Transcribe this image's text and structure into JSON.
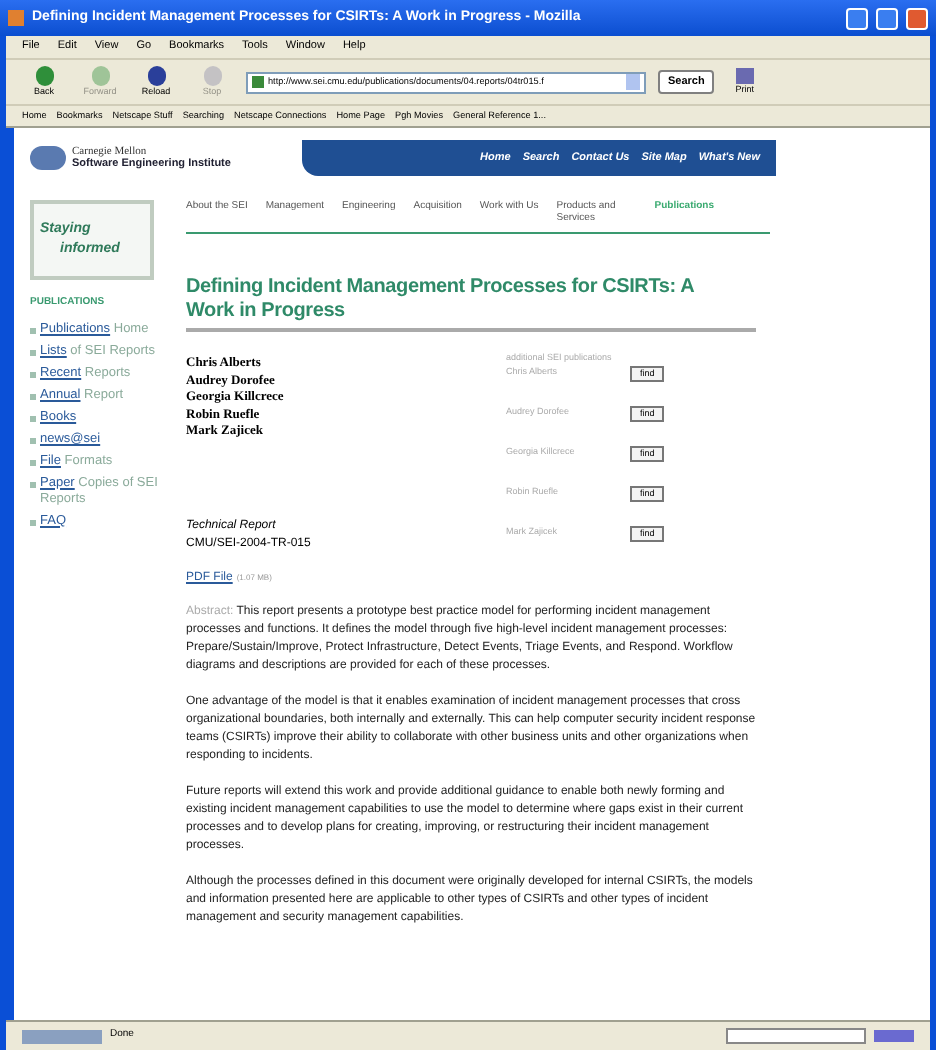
{
  "window": {
    "title": "Defining Incident Management Processes for CSIRTs: A Work in Progress - Mozilla"
  },
  "menu": [
    "File",
    "Edit",
    "View",
    "Go",
    "Bookmarks",
    "Tools",
    "Window",
    "Help"
  ],
  "toolbar": [
    {
      "label": "Back",
      "disabled": false
    },
    {
      "label": "Forward",
      "disabled": true
    },
    {
      "label": "Reload",
      "disabled": false
    },
    {
      "label": "Stop",
      "disabled": true
    }
  ],
  "address": {
    "value": "http://www.sei.cmu.edu/publications/documents/04.reports/04tr015.f"
  },
  "search_button": "Search",
  "print_button": "Print",
  "bookmarks": [
    "Home",
    "Bookmarks",
    "Netscape Stuff",
    "Searching",
    "Netscape Connections",
    "Home Page",
    "Pgh Movies",
    "General Reference 1..."
  ],
  "page": {
    "logo": {
      "line_1": "Carnegie Mellon",
      "line_2": "Software Engineering Institute"
    },
    "top_nav": [
      "Home",
      "Search",
      "Contact Us",
      "Site Map",
      "What's New"
    ],
    "banner": {
      "line_1": "Staying",
      "line_2": "informed"
    },
    "section_nav": [
      {
        "label": "About the SEI",
        "selected": false
      },
      {
        "label": "Management",
        "selected": false
      },
      {
        "label": "Engineering",
        "selected": false
      },
      {
        "label": "Acquisition",
        "selected": false
      },
      {
        "label": "Work with Us",
        "selected": false
      },
      {
        "label": "Products and Services",
        "selected": false
      },
      {
        "label": "Publications",
        "selected": true
      }
    ],
    "sidebar": {
      "heading": "PUBLICATIONS",
      "items": [
        {
          "link": "Publications",
          "rest": "Home"
        },
        {
          "link": "Lists",
          "rest": "of SEI Reports"
        },
        {
          "link": "Recent",
          "rest": "Reports"
        },
        {
          "link": "Annual",
          "rest": "Report"
        },
        {
          "link": "Books"
        },
        {
          "link": "news@sei"
        },
        {
          "link": "File",
          "rest": "Formats"
        },
        {
          "link": "Paper",
          "rest": "Copies of SEI Reports"
        },
        {
          "link": "FAQ"
        }
      ]
    },
    "title": "Defining Incident Management Processes for CSIRTs: A Work in Progress",
    "authors": [
      "Chris Alberts",
      "Audrey Dorofee",
      "Georgia Killcrece",
      "Robin Ruefle",
      "Mark Zajicek"
    ],
    "related": {
      "heading": "additional SEI publications",
      "rows": [
        {
          "name": "Chris Alberts",
          "button": "find"
        },
        {
          "name": "Audrey Dorofee",
          "button": "find"
        },
        {
          "name": "Georgia Killcrece",
          "button": "find"
        },
        {
          "name": "Robin Ruefle",
          "button": "find"
        },
        {
          "name": "Mark Zajicek",
          "button": "find"
        }
      ]
    },
    "report_type": "Technical Report",
    "report_number": "CMU/SEI-2004-TR-015",
    "pdf": {
      "link": "PDF File",
      "size": "(1.07 MB)"
    },
    "abstract_label": "Abstract:",
    "paragraphs": [
      "This report presents a prototype best practice model for performing incident management processes and functions. It defines the model through five high-level incident management processes: Prepare/Sustain/Improve, Protect Infrastructure, Detect Events, Triage Events, and Respond. Workflow diagrams and descriptions are provided for each of these processes.",
      "One advantage of the model is that it enables examination of incident management processes that cross organizational boundaries, both internally and externally. This can help computer security incident response teams (CSIRTs) improve their ability to collaborate with other business units and other organizations when responding to incidents.",
      "Future reports will extend this work and provide additional guidance to enable both newly forming and existing incident management capabilities to use the model to determine where gaps exist in their current processes and to develop plans for creating, improving, or restructuring their incident management processes.",
      "Although the processes defined in this document were originally developed for internal CSIRTs, the models and information presented here are applicable to other types of CSIRTs and other types of incident management and security management capabilities."
    ]
  },
  "status_bar": {
    "text": "Done"
  }
}
